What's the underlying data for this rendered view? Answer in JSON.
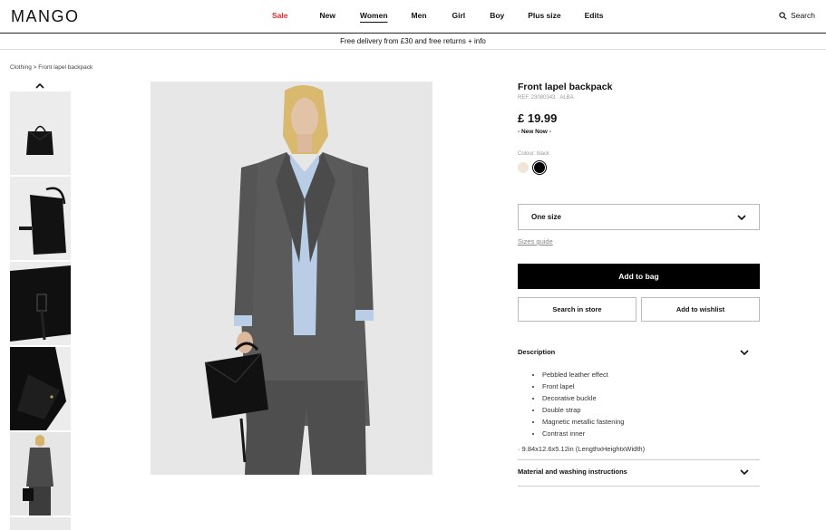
{
  "header": {
    "logo": "MANGO",
    "nav": [
      "Sale",
      "New",
      "Women",
      "Men",
      "Girl",
      "Boy",
      "Plus size",
      "Edits"
    ],
    "active_nav": "Women",
    "search_label": "Search"
  },
  "promo": "Free delivery from £30 and free returns + info",
  "breadcrumb": "Clothing > Front lapel backpack",
  "product": {
    "title": "Front lapel backpack",
    "ref": "REF. 23080343 · ALBA",
    "price": "£ 19.99",
    "badge": "- New Now -",
    "colour_label": "Colour: black",
    "colours": [
      "#efe6d5",
      "#000000"
    ],
    "size_value": "One size",
    "sizes_guide": "Sizes guide",
    "add_to_bag": "Add to bag",
    "search_in_store": "Search in store",
    "add_to_wishlist": "Add to wishlist"
  },
  "description": {
    "heading": "Description",
    "items": [
      "Pebbled leather effect",
      "Front lapel",
      "Decorative buckle",
      "Double strap",
      "Magnetic metallic fastening",
      "Contrast inner"
    ],
    "dimensions": "· 9.84x12.6x5.12in (LengthxHeightxWidth)"
  },
  "material_heading": "Material and washing instructions"
}
